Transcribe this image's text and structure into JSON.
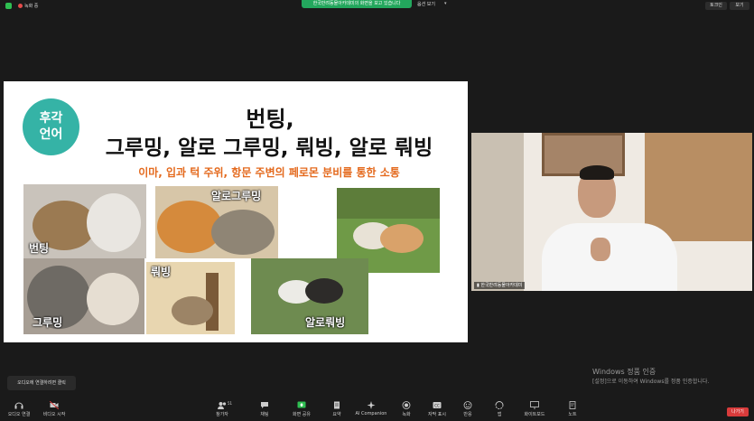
{
  "topbar": {
    "recording_label": "녹화 중",
    "share_banner": "한국반려동물아카데미의 화면을 보고 있습니다",
    "view_options": "옵션 보기",
    "btn_left": "토크인",
    "btn_right": "보기"
  },
  "slide": {
    "badge_line1": "후각",
    "badge_line2": "언어",
    "title_line1": "번팅,",
    "title_line2": "그루밍, 알로 그루밍, 뤄빙, 알로 뤄빙",
    "subtitle": "이마, 입과 턱 주위, 항문 주변의 페로몬 분비를 통한 소통",
    "captions": {
      "bunting": "번팅",
      "allogrooming": "알로그루밍",
      "grooming": "그루밍",
      "rubbing": "뤄빙",
      "allorubbing": "알로뤄빙"
    }
  },
  "video": {
    "participant_name": "한국반려동물아카데미"
  },
  "windows_activation": {
    "line1": "Windows 정품 인증",
    "line2": "[설정]으로 이동하여 Windows를 정품 인증합니다."
  },
  "tooltip": "오디오에 연결하려면 클릭",
  "toolbar": {
    "audio": "오디오 연결",
    "video": "비디오 시작",
    "participants": "참가자",
    "participants_count": "51",
    "chat": "채팅",
    "share": "화면 공유",
    "summary": "요약",
    "ai": "AI Companion",
    "record": "녹화",
    "captions": "자막 표시",
    "reactions": "반응",
    "apps": "앱",
    "whiteboard": "화이트보드",
    "notes": "노트",
    "leave": "나가기"
  },
  "colors": {
    "badge": "#35b3a6",
    "subtitle": "#e46a1e",
    "share_banner": "#23a75d",
    "leave": "#d83b3b"
  }
}
